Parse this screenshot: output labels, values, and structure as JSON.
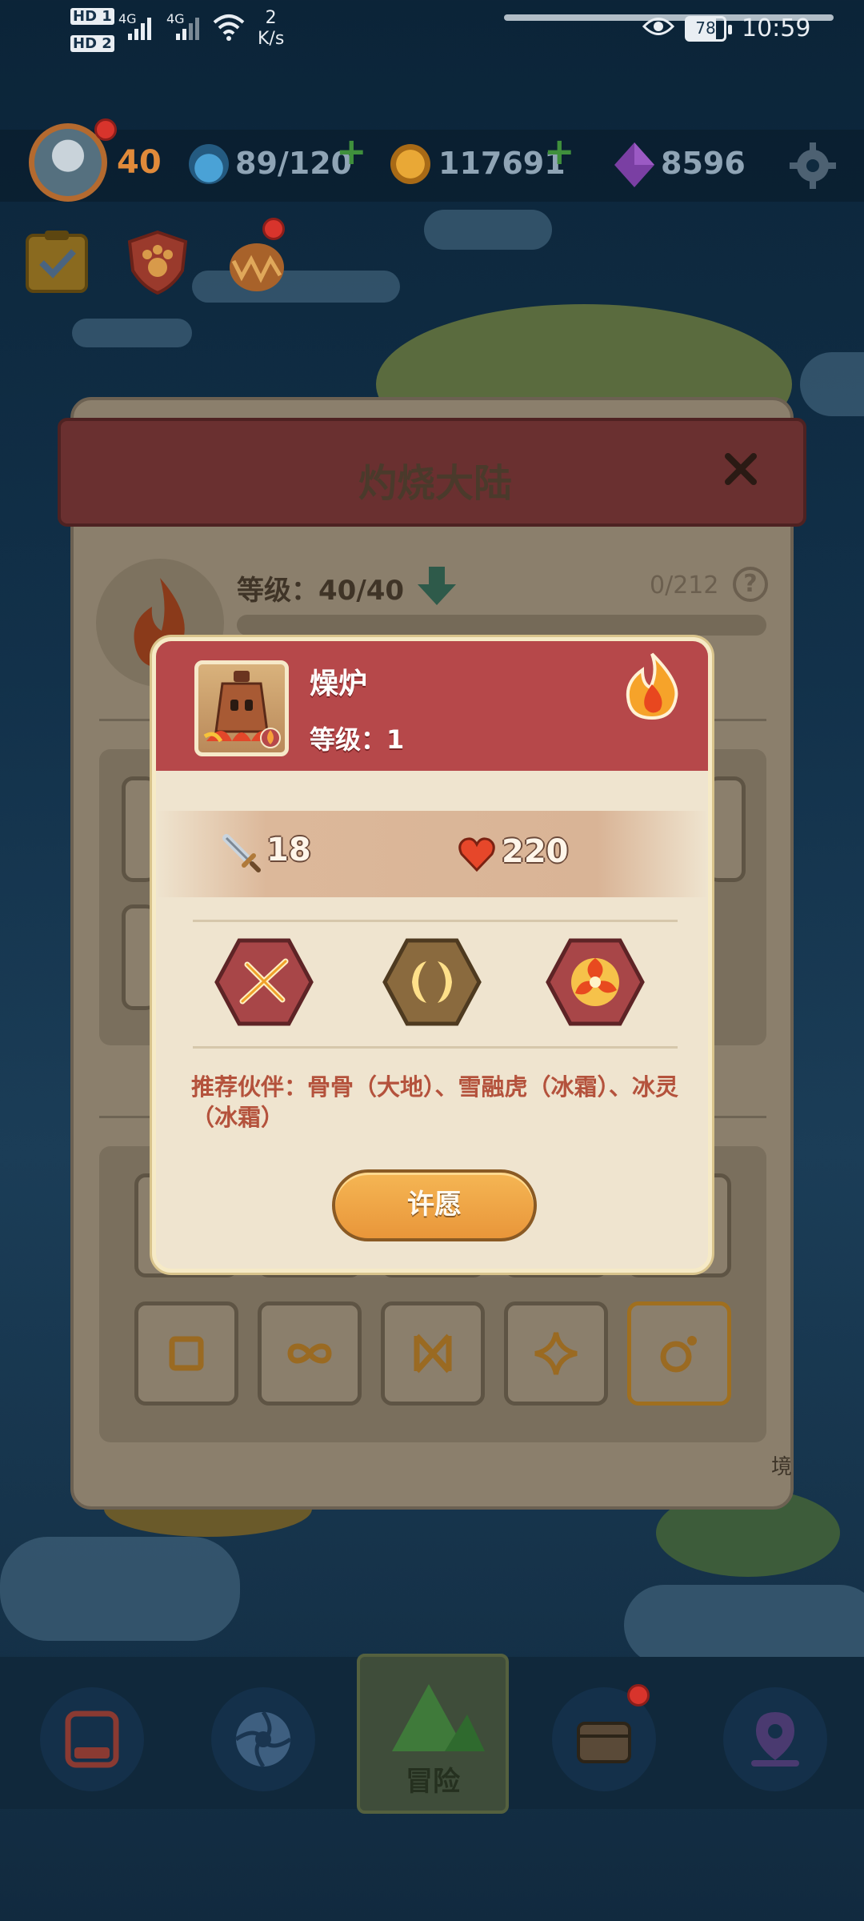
{
  "status_bar": {
    "hd1": "HD 1",
    "hd2": "HD 2",
    "signal1": "4G",
    "signal2": "4G",
    "speed_value": "2",
    "speed_unit": "K/s",
    "battery": "78",
    "time": "10:59"
  },
  "hud": {
    "player_level": "40",
    "energy": "89/120",
    "coins": "117691",
    "gems": "8596"
  },
  "back_panel": {
    "title": "灼烧大陆",
    "level_text": "等级：40/40",
    "progress_text": "0/212",
    "help": "?",
    "corner_tag": "境"
  },
  "modal": {
    "pet_name": "燥炉",
    "pet_level": "等级：1",
    "attack": "18",
    "health": "220",
    "skills": [
      "cross-slash-skill-icon",
      "twin-moon-skill-icon",
      "fire-swirl-skill-icon"
    ],
    "recommend": "推荐伙伴：骨骨（大地）、雪融虎（冰霜）、冰灵（冰霜）",
    "wish_button": "许愿"
  },
  "nav": {
    "active_label": "冒险",
    "items": [
      "device-icon",
      "aperture-icon",
      "mountain-icon",
      "chest-icon",
      "map-pin-icon"
    ]
  },
  "colors": {
    "modal_header": "#b6484a",
    "modal_bg": "#efe4cf",
    "wish_button": "#f0a848",
    "recommend_text": "#b4523c"
  }
}
